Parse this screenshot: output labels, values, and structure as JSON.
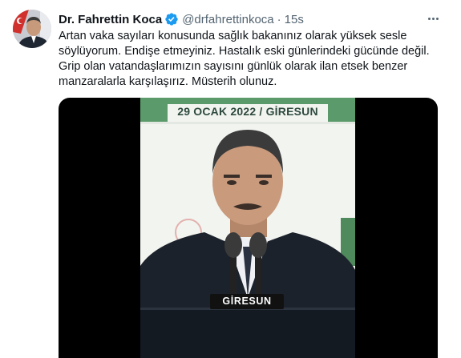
{
  "tweet": {
    "author_name": "Dr. Fahrettin Koca",
    "handle": "@drfahrettinkoca",
    "separator": "·",
    "time": "15s",
    "text_lines": [
      "Artan vaka sayıları konusunda sağlık bakanınız olarak yüksek sesle",
      "söylüyorum. Endişe etmeyiniz. Hastalık eski günlerindeki gücünde değil.",
      "Grip olan vatandaşlarımızın sayısını günlük olarak ilan etsek benzer",
      "manzaralarla karşılaşırız. Müsterih olunuz."
    ]
  },
  "media": {
    "banner_text": "29 OCAK 2022 / GİRESUN",
    "podium_text": "GİRESUN"
  },
  "icons": {
    "verified": "verified-badge-icon",
    "more": "more-options-icon",
    "avatar": "avatar"
  },
  "colors": {
    "name": "#0f1419",
    "secondary": "#536471",
    "verified": "#1d9bf0",
    "banner_green": "#5b9a6a"
  }
}
